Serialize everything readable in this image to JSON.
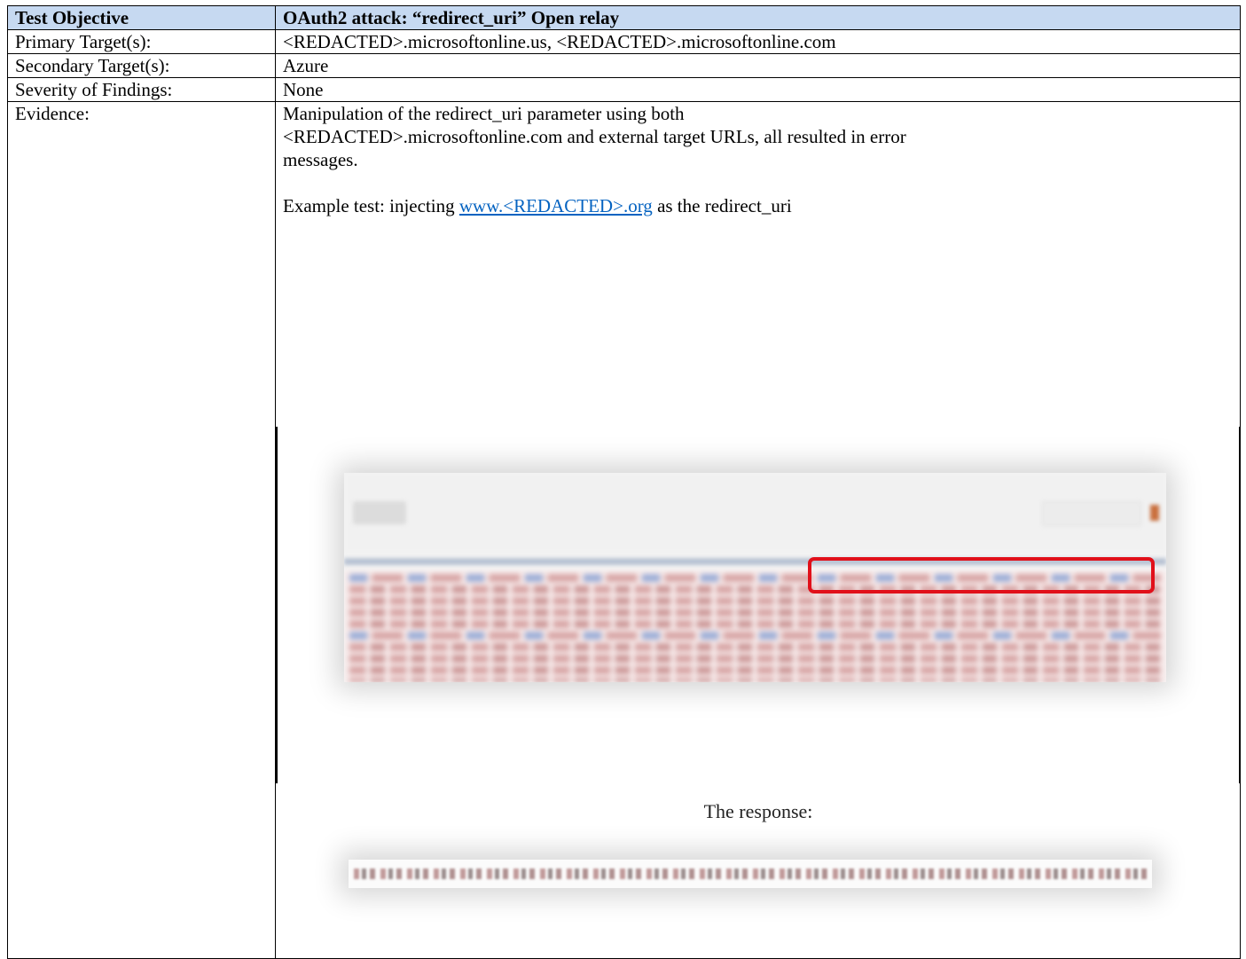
{
  "header": {
    "col1": "Test Objective",
    "col2": "OAuth2 attack: “redirect_uri” Open relay"
  },
  "rows": [
    {
      "label": "Primary Target(s):",
      "value": "<REDACTED>.microsoftonline.us, <REDACTED>.microsoftonline.com"
    },
    {
      "label": "Secondary Target(s):",
      "value": "Azure"
    },
    {
      "label": "Severity of Findings:",
      "value": "None"
    }
  ],
  "evidence": {
    "label": "Evidence:",
    "paragraph_line1": "Manipulation of the redirect_uri parameter using both",
    "paragraph_line2": "<REDACTED>.microsoftonline.com and external target URLs, all resulted in error",
    "paragraph_line3": "messages.",
    "example_prefix": "Example test: injecting ",
    "example_link": "www.<REDACTED>.org",
    "example_suffix": " as the redirect_uri",
    "caption": "The response:"
  },
  "colors": {
    "header_bg": "#c6d9f1",
    "link": "#0563c1",
    "highlight_box": "#e1101a"
  }
}
